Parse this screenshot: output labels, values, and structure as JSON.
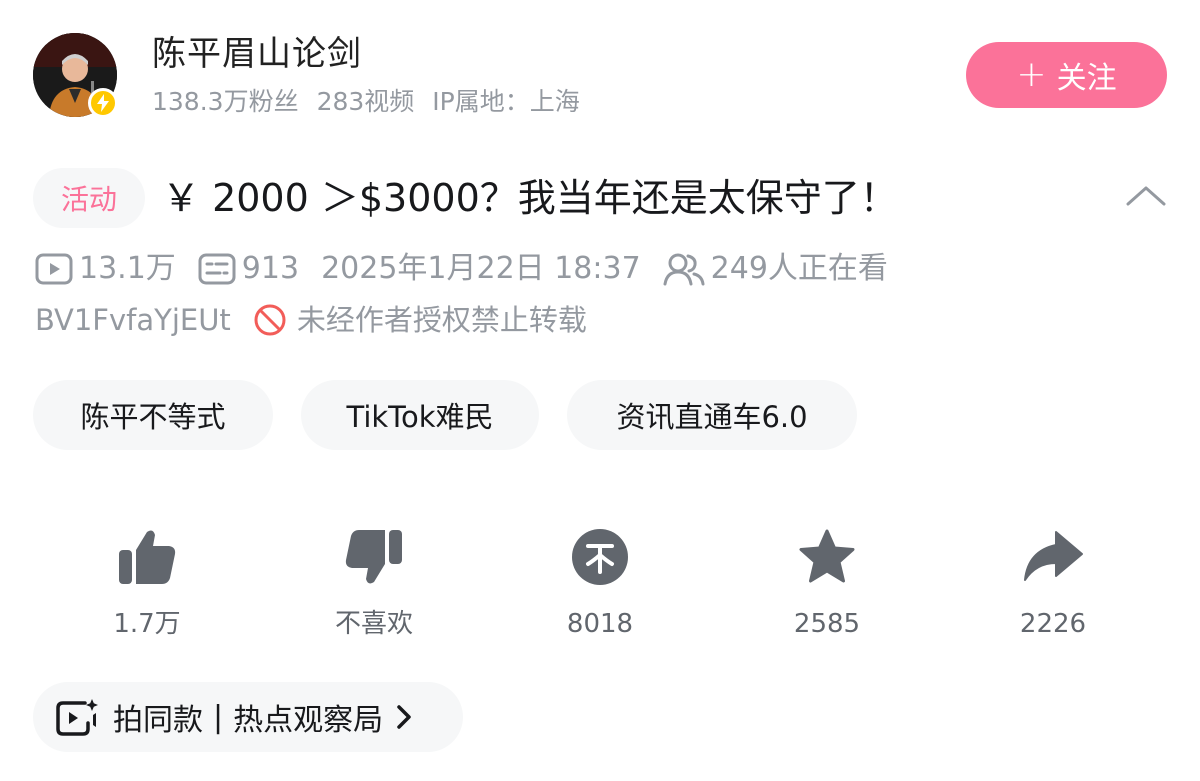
{
  "user": {
    "name": "陈平眉山论剑",
    "followers": "138.3万粉丝",
    "videos": "283视频",
    "ip": "IP属地：上海",
    "follow_label": "关注",
    "follow_plus": "+",
    "verify_color": "#ffc800"
  },
  "video": {
    "tag": "活动",
    "title": "￥ 2000 ＞$3000？我当年还是太保守了！",
    "views": "13.1万",
    "danmaku": "913",
    "date": "2025年1月22日 18:37",
    "watching": "249人正在看",
    "bvid": "BV1FvfaYjEUt",
    "copyright": "未经作者授权禁止转载"
  },
  "tags": [
    "陈平不等式",
    "TikTok难民",
    "资讯直通车6.0"
  ],
  "actions": {
    "like": "1.7万",
    "dislike": "不喜欢",
    "coin": "8018",
    "favorite": "2585",
    "share": "2226"
  },
  "bottom": {
    "left": "拍同款",
    "sep": "|",
    "right": "热点观察局"
  },
  "colors": {
    "accent_pink": "#fb7299",
    "grey_text": "#9499a0",
    "icon_grey": "#61666d",
    "chip_bg": "#f6f7f8"
  },
  "icons": {
    "verify": "lightning-icon",
    "views": "play-icon",
    "danmaku": "danmaku-icon",
    "watching": "people-icon",
    "copyright": "forbidden-icon",
    "like": "thumbs-up-icon",
    "dislike": "thumbs-down-icon",
    "coin": "coin-icon",
    "favorite": "star-icon",
    "share": "share-icon",
    "collapse": "chevron-up-icon"
  }
}
